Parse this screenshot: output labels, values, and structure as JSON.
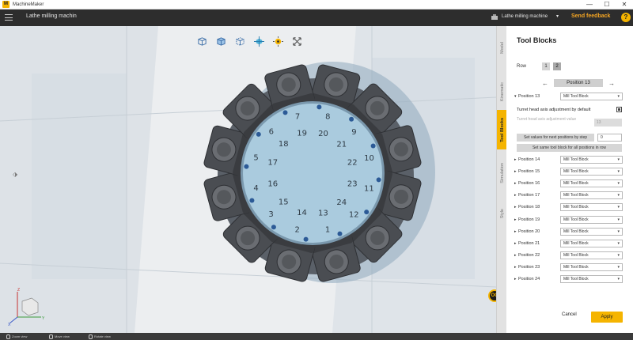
{
  "window": {
    "title": "MachineMaker",
    "logo_glyph": "M",
    "minimize": "—",
    "maximize": "☐",
    "close": "✕"
  },
  "header": {
    "title": "Lathe milling machin",
    "machine_name": "Lathe milling machine",
    "caret": "▾",
    "feedback": "Send feedback",
    "help": "?"
  },
  "viewport": {
    "ortho_label": "OC",
    "toolbar_icons": [
      "cube-left-view-icon",
      "cube-front-view-icon",
      "cube-wireframe-icon",
      "cube-axes-icon",
      "light-bulb-icon",
      "expand-arrows-icon"
    ],
    "turret_labels": [
      "1",
      "2",
      "3",
      "4",
      "5",
      "6",
      "7",
      "8",
      "9",
      "10",
      "11",
      "12",
      "13",
      "14",
      "15",
      "16",
      "17",
      "18",
      "19",
      "20",
      "21",
      "22",
      "23",
      "24"
    ],
    "axis": {
      "x": "X",
      "y": "Y",
      "z": "Z"
    }
  },
  "side_tabs": [
    {
      "label": "Model",
      "active": false
    },
    {
      "label": "Kinematic",
      "active": false
    },
    {
      "label": "Tool Blocks",
      "active": true
    },
    {
      "label": "Simulation",
      "active": false
    },
    {
      "label": "Style",
      "active": false
    }
  ],
  "panel": {
    "title": "Tool Blocks",
    "row_label": "Row",
    "rows": [
      "1",
      "2"
    ],
    "active_row": "2",
    "nav_prev": "←",
    "nav_next": "→",
    "current_position": "Position 13",
    "expanded": {
      "label": "Position 13",
      "block": "Mill Tool Block"
    },
    "turret_adjust_label": "Turret head axis adjustment by default",
    "turret_adjust_checked": true,
    "adjust_value_label": "Turret head axis adjustment value",
    "adjust_value": "13",
    "set_step_label": "Set values for next positions by step",
    "step_value": "0",
    "same_block_label": "Set same tool block for all positions in row",
    "positions": [
      {
        "label": "Position 14",
        "block": "Mill Tool Block"
      },
      {
        "label": "Position 15",
        "block": "Mill Tool Block"
      },
      {
        "label": "Position 16",
        "block": "Mill Tool Block"
      },
      {
        "label": "Position 17",
        "block": "Mill Tool Block"
      },
      {
        "label": "Position 18",
        "block": "Mill Tool Block"
      },
      {
        "label": "Position 19",
        "block": "Mill Tool Block"
      },
      {
        "label": "Position 20",
        "block": "Mill Tool Block"
      },
      {
        "label": "Position 21",
        "block": "Mill Tool Block"
      },
      {
        "label": "Position 22",
        "block": "Mill Tool Block"
      },
      {
        "label": "Position 23",
        "block": "Mill Tool Block"
      },
      {
        "label": "Position 24",
        "block": "Mill Tool Block"
      }
    ],
    "collapsed_glyph": "▸",
    "expanded_glyph": "▾",
    "cancel": "Cancel",
    "apply": "Apply"
  },
  "statusbar": {
    "zoom": "Zoom view",
    "move": "Move view",
    "rotate": "Rotate view"
  },
  "colors": {
    "accent": "#f5b400",
    "feedback": "#f5a623",
    "turret_face": "#aacbde",
    "tool_block": "#4a4d52",
    "dot": "#2c5a96"
  }
}
